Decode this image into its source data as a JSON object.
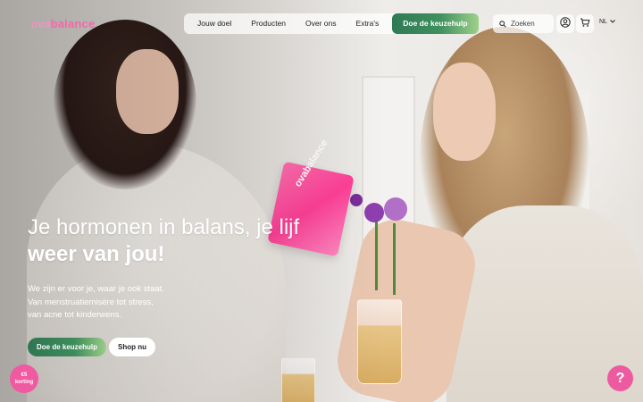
{
  "brand": {
    "logo_prefix": "ova",
    "logo_suffix": "balance",
    "accent": "#f26aa9",
    "cta_green": "#2f7a55"
  },
  "nav": {
    "items": [
      {
        "label": "Jouw doel"
      },
      {
        "label": "Producten"
      },
      {
        "label": "Over ons"
      },
      {
        "label": "Extra's"
      }
    ],
    "cta_label": "Doe de keuzehulp"
  },
  "search": {
    "placeholder": "Zoeken"
  },
  "language": {
    "current": "NL"
  },
  "hero": {
    "headline_regular": "Je hormonen in balans, je lijf ",
    "headline_bold": "weer van jou!",
    "subcopy_lines": [
      "We zijn er voor je, waar je ook staat.",
      "Van menstruatiemisère tot stress,",
      "van acne tot kinderwens."
    ],
    "primary_button": "Doe de keuzehulp",
    "secondary_button": "Shop nu",
    "product_label": "ovabalance"
  },
  "floating": {
    "discount_line1": "€5",
    "discount_line2": "korting",
    "help_symbol": "?"
  },
  "icons": {
    "search": "search-icon",
    "account": "account-icon",
    "cart": "cart-icon",
    "chevron": "chevron-down-icon"
  }
}
